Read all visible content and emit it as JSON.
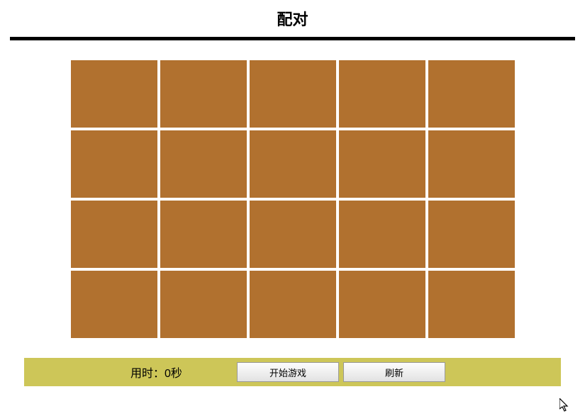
{
  "header": {
    "title": "配对"
  },
  "board": {
    "rows": 4,
    "cols": 5,
    "card_color": "#b1712f"
  },
  "footer": {
    "timer_prefix": "用时：",
    "timer_value": "0",
    "timer_suffix": "秒",
    "start_button": "开始游戏",
    "refresh_button": "刷新"
  }
}
